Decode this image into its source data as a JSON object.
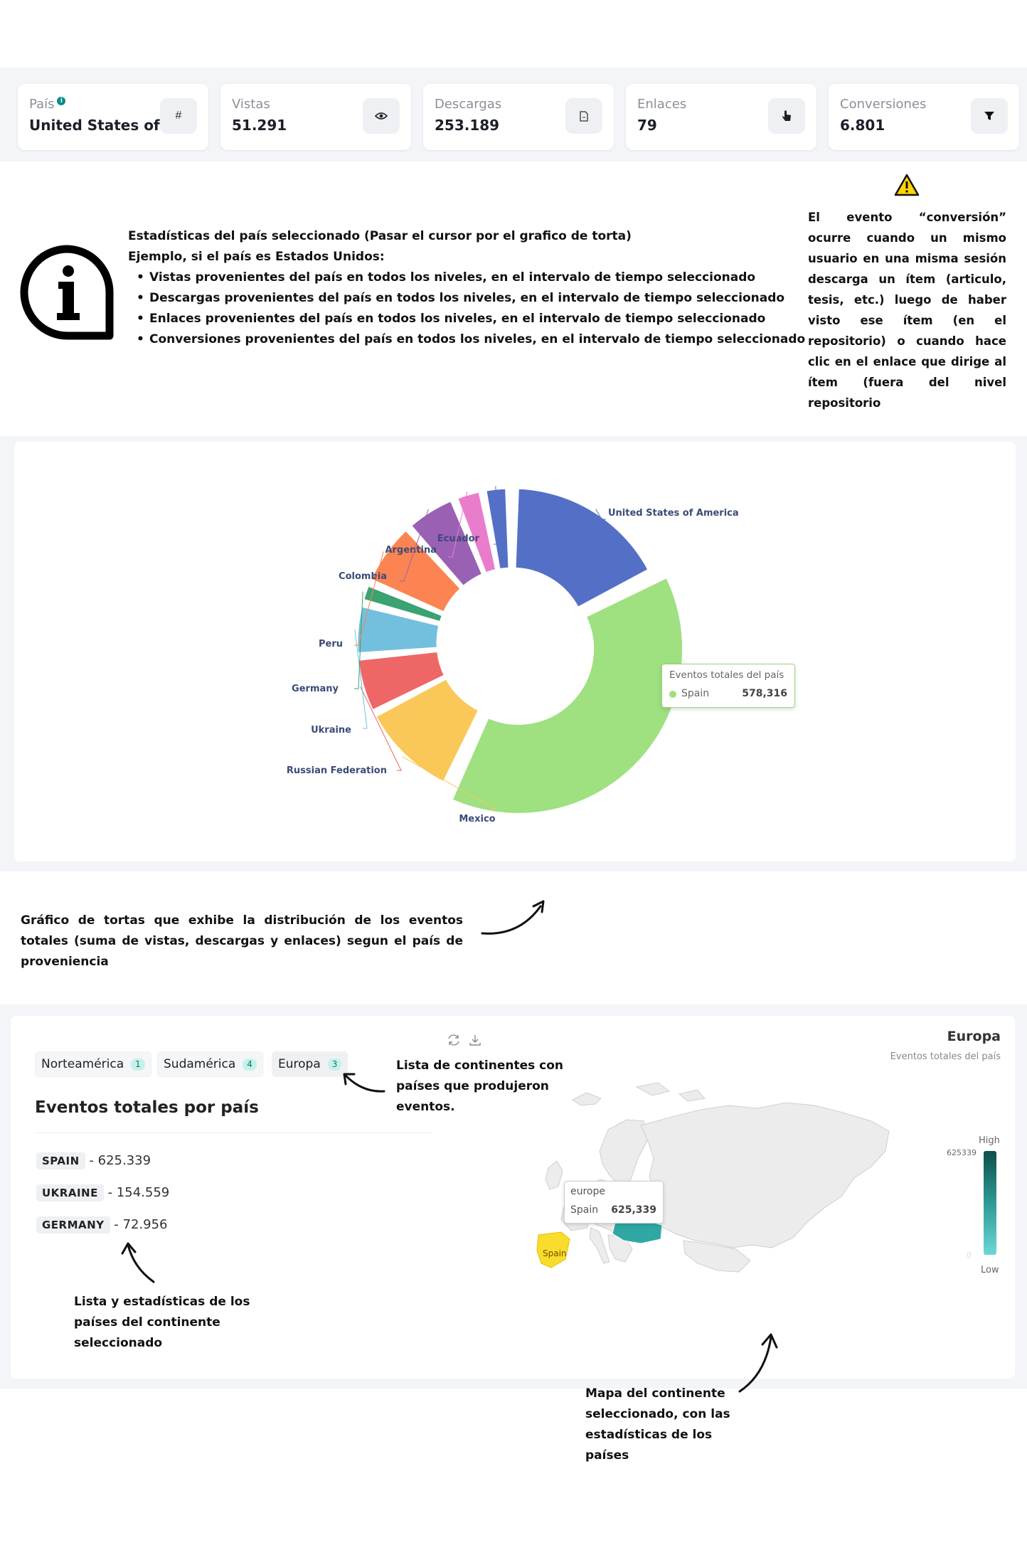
{
  "kpis": [
    {
      "label": "País",
      "value": "United States of A...",
      "button_icon": "#"
    },
    {
      "label": "Vistas",
      "value": "51.291",
      "button_icon": "eye-icon"
    },
    {
      "label": "Descargas",
      "value": "253.189",
      "button_icon": "file-icon"
    },
    {
      "label": "Enlaces",
      "value": "79",
      "button_icon": "pointer-icon"
    },
    {
      "label": "Conversiones",
      "value": "6.801",
      "button_icon": "filter-icon"
    }
  ],
  "info": {
    "title": "Estadísticas del país seleccionado (Pasar el cursor por el grafico de torta)",
    "example": "Ejemplo, si el país es Estados Unidos:",
    "bullets": [
      "Vistas provenientes del país en todos los niveles, en el intervalo de tiempo seleccionado",
      "Descargas provenientes del país en todos los niveles, en el intervalo de tiempo seleccionado",
      "Enlaces provenientes del país en todos los niveles, en el intervalo de tiempo seleccionado",
      "Conversiones provenientes del país en todos los niveles, en el intervalo de tiempo seleccionado"
    ]
  },
  "warning": {
    "text": "El evento “conversión” ocurre cuando un mismo usuario en una misma sesión descarga un ítem (articulo, tesis, etc.) luego de haber visto ese ítem (en el repositorio) o cuando hace clic en el enlace que dirige al ítem (fuera del nivel repositorio"
  },
  "pie": {
    "slices": [
      {
        "name": "United States of America",
        "color": "#5470c6"
      },
      {
        "name": "Spain",
        "color": "#9fe080"
      },
      {
        "name": "Mexico",
        "color": "#fac858"
      },
      {
        "name": "Russian Federation",
        "color": "#ee6666"
      },
      {
        "name": "Ukraine",
        "color": "#73c0de"
      },
      {
        "name": "Germany",
        "color": "#3ba272"
      },
      {
        "name": "Peru",
        "color": "#fc8452"
      },
      {
        "name": "Colombia",
        "color": "#9a60b4"
      },
      {
        "name": "Argentina",
        "color": "#ea7ccc"
      },
      {
        "name": "Ecuador",
        "color": "#5470c6"
      }
    ],
    "tooltip": {
      "title": "Eventos totales del país",
      "name": "Spain",
      "value": "578,316"
    }
  },
  "annotations": {
    "pie": "Gráfico de tortas que exhibe la distribución de los eventos totales (suma de vistas, descargas y enlaces) segun el país de proveniencia",
    "continents": "Lista de continentes con países que produjeron eventos.",
    "countries": "Lista y estadísticas de los países del continente seleccionado",
    "map": "Mapa del continente seleccionado, con las estadísticas de los países"
  },
  "continents": [
    {
      "label": "Norteamérica",
      "count": "1"
    },
    {
      "label": "Sudamérica",
      "count": "4"
    },
    {
      "label": "Europa",
      "count": "3"
    }
  ],
  "europe": {
    "title": "Eventos totales por país",
    "countries": [
      {
        "name": "SPAIN",
        "value": "- 625.339"
      },
      {
        "name": "UKRAINE",
        "value": "- 154.559"
      },
      {
        "name": "GERMANY",
        "value": "- 72.956"
      }
    ]
  },
  "map": {
    "title": "Europa",
    "subtitle": "Eventos totales del país",
    "legend_high": "High",
    "legend_low": "Low",
    "legend_max": "625339",
    "legend_min": "0",
    "spain_label": "Spain",
    "tooltip": {
      "group": "europe",
      "name": "Spain",
      "value": "625,339"
    }
  }
}
